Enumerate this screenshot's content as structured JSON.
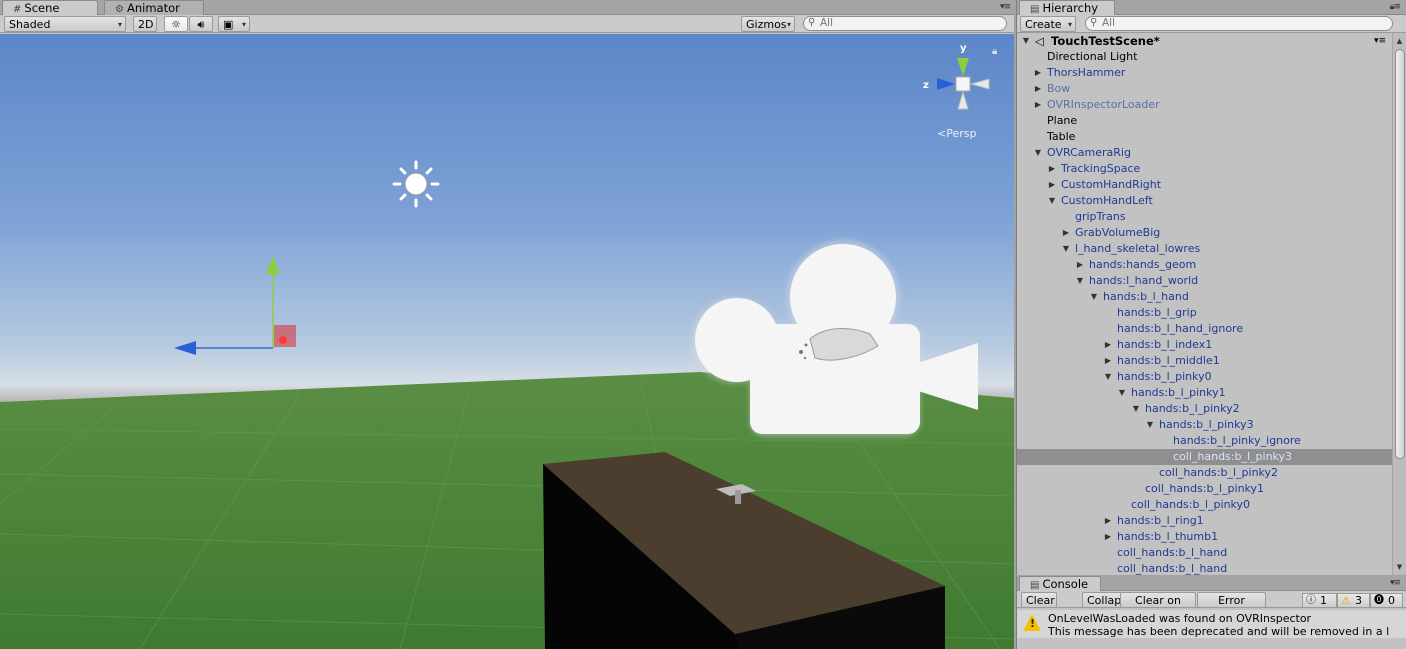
{
  "scene_panel": {
    "tabs": [
      {
        "label": "Scene",
        "icon": "grid-icon",
        "active": true
      },
      {
        "label": "Animator",
        "icon": "animator-icon",
        "active": false
      }
    ],
    "toolbar": {
      "shading_mode": "Shaded",
      "mode_2d": "2D",
      "gizmos_label": "Gizmos",
      "search_placeholder": "All"
    },
    "gizmo": {
      "y_label": "y",
      "z_label": "z",
      "projection": "Persp"
    }
  },
  "hierarchy": {
    "tab_label": "Hierarchy",
    "create_label": "Create",
    "search_placeholder": "All",
    "scene_name": "TouchTestScene*",
    "rows": [
      {
        "label": "Directional Light",
        "depth": 0,
        "arrow": "",
        "style": "normal"
      },
      {
        "label": "ThorsHammer",
        "depth": 0,
        "arrow": "right",
        "style": "prefab"
      },
      {
        "label": "Bow",
        "depth": 0,
        "arrow": "right",
        "style": "prefab-dim"
      },
      {
        "label": "OVRInspectorLoader",
        "depth": 0,
        "arrow": "right",
        "style": "prefab-dim"
      },
      {
        "label": "Plane",
        "depth": 0,
        "arrow": "",
        "style": "normal"
      },
      {
        "label": "Table",
        "depth": 0,
        "arrow": "",
        "style": "normal"
      },
      {
        "label": "OVRCameraRig",
        "depth": 0,
        "arrow": "down",
        "style": "prefab"
      },
      {
        "label": "TrackingSpace",
        "depth": 1,
        "arrow": "right",
        "style": "prefab"
      },
      {
        "label": "CustomHandRight",
        "depth": 1,
        "arrow": "right",
        "style": "prefab"
      },
      {
        "label": "CustomHandLeft",
        "depth": 1,
        "arrow": "down",
        "style": "prefab"
      },
      {
        "label": "gripTrans",
        "depth": 2,
        "arrow": "",
        "style": "prefab"
      },
      {
        "label": "GrabVolumeBig",
        "depth": 2,
        "arrow": "right",
        "style": "prefab"
      },
      {
        "label": "l_hand_skeletal_lowres",
        "depth": 2,
        "arrow": "down",
        "style": "prefab"
      },
      {
        "label": "hands:hands_geom",
        "depth": 3,
        "arrow": "right",
        "style": "prefab"
      },
      {
        "label": "hands:l_hand_world",
        "depth": 3,
        "arrow": "down",
        "style": "prefab"
      },
      {
        "label": "hands:b_l_hand",
        "depth": 4,
        "arrow": "down",
        "style": "prefab"
      },
      {
        "label": "hands:b_l_grip",
        "depth": 5,
        "arrow": "",
        "style": "prefab"
      },
      {
        "label": "hands:b_l_hand_ignore",
        "depth": 5,
        "arrow": "",
        "style": "prefab"
      },
      {
        "label": "hands:b_l_index1",
        "depth": 5,
        "arrow": "right",
        "style": "prefab"
      },
      {
        "label": "hands:b_l_middle1",
        "depth": 5,
        "arrow": "right",
        "style": "prefab"
      },
      {
        "label": "hands:b_l_pinky0",
        "depth": 5,
        "arrow": "down",
        "style": "prefab"
      },
      {
        "label": "hands:b_l_pinky1",
        "depth": 6,
        "arrow": "down",
        "style": "prefab"
      },
      {
        "label": "hands:b_l_pinky2",
        "depth": 7,
        "arrow": "down",
        "style": "prefab"
      },
      {
        "label": "hands:b_l_pinky3",
        "depth": 8,
        "arrow": "down",
        "style": "prefab"
      },
      {
        "label": "hands:b_l_pinky_ignore",
        "depth": 9,
        "arrow": "",
        "style": "prefab"
      },
      {
        "label": "coll_hands:b_l_pinky3",
        "depth": 9,
        "arrow": "",
        "style": "prefab",
        "selected": true
      },
      {
        "label": "coll_hands:b_l_pinky2",
        "depth": 8,
        "arrow": "",
        "style": "prefab"
      },
      {
        "label": "coll_hands:b_l_pinky1",
        "depth": 7,
        "arrow": "",
        "style": "prefab"
      },
      {
        "label": "coll_hands:b_l_pinky0",
        "depth": 6,
        "arrow": "",
        "style": "prefab"
      },
      {
        "label": "hands:b_l_ring1",
        "depth": 5,
        "arrow": "right",
        "style": "prefab"
      },
      {
        "label": "hands:b_l_thumb1",
        "depth": 5,
        "arrow": "right",
        "style": "prefab"
      },
      {
        "label": "coll_hands:b_l_hand",
        "depth": 5,
        "arrow": "",
        "style": "prefab"
      },
      {
        "label": "coll_hands:b_l_hand",
        "depth": 5,
        "arrow": "",
        "style": "prefab"
      }
    ]
  },
  "console": {
    "tab_label": "Console",
    "buttons": {
      "clear": "Clear",
      "collapse": "Collapse",
      "clear_on_play": "Clear on Play",
      "error_pause": "Error Pause"
    },
    "counts": {
      "info": "1",
      "warning": "3",
      "error": "0"
    },
    "messages": [
      {
        "line1": "OnLevelWasLoaded was found on OVRInspector",
        "line2": "This message has been deprecated and will be removed in a l"
      }
    ]
  },
  "colors": {
    "selection": "#8f8f8f",
    "prefab_text": "#1f3a93",
    "ground_green": "#4e8a3c",
    "table_top": "#4b3e2f"
  }
}
